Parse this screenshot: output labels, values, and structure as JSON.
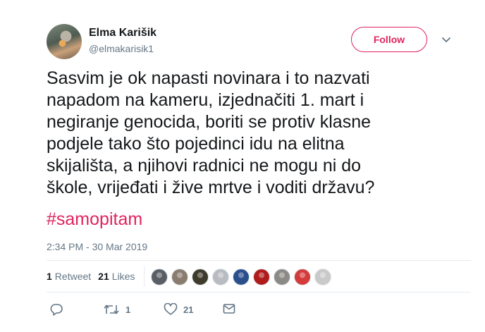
{
  "author": {
    "name": "Elma Karišik",
    "handle": "@elmakarisik1"
  },
  "follow_label": "Follow",
  "tweet": {
    "text": "Sasvim je ok napasti novinara i to nazvati\nnapadom na kameru, izjednačiti 1. mart i\nnegiranje genocida, boriti se protiv klasne\npodjele  tako što pojedinci idu na elitna\nskijališta, a njihovi radnici ne mogu ni do\nškole, vrijeđati i žive mrtve i voditi državu?",
    "hashtag": "#samopitam",
    "timestamp": "2:34 PM - 30 Mar 2019"
  },
  "stats": {
    "retweets_count": "1",
    "retweets_label": "Retweet",
    "likes_count": "21",
    "likes_label": "Likes"
  },
  "liker_avatars": [
    "#5a5f66",
    "#8a7d70",
    "#3f3b2c",
    "#b8bcc2",
    "#2a4f8c",
    "#b01b1b",
    "#8c8a86",
    "#d43b3b",
    "#c9c9c9"
  ],
  "actions": {
    "reply_icon": "reply-icon",
    "retweet_icon": "retweet-icon",
    "retweet_count": "1",
    "like_icon": "heart-icon",
    "like_count": "21",
    "message_icon": "envelope-icon"
  },
  "colors": {
    "accent": "#e0245e",
    "secondary_text": "#657786",
    "primary_text": "#14171a"
  }
}
